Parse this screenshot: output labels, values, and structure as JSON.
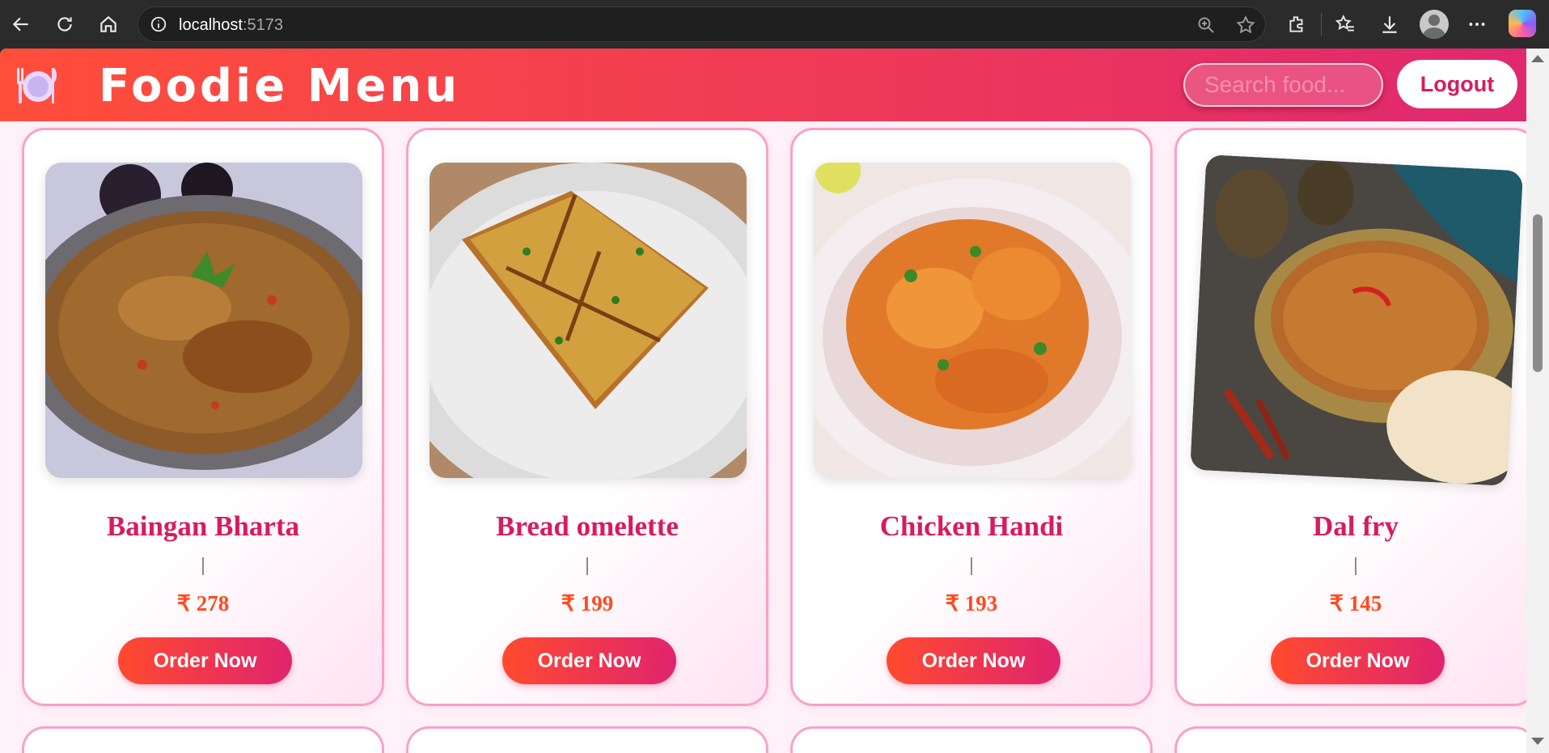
{
  "browser": {
    "url_host": "localhost",
    "url_port": ":5173"
  },
  "header": {
    "title": "Foodie Menu",
    "search_placeholder": "Search food...",
    "logout_label": "Logout"
  },
  "menu": {
    "items": [
      {
        "name": "Baingan Bharta",
        "divider": "|",
        "price": "₹ 278",
        "order_label": "Order Now"
      },
      {
        "name": "Bread omelette",
        "divider": "|",
        "price": "₹ 199",
        "order_label": "Order Now"
      },
      {
        "name": "Chicken Handi",
        "divider": "|",
        "price": "₹ 193",
        "order_label": "Order Now"
      },
      {
        "name": "Dal fry",
        "divider": "|",
        "price": "₹ 145",
        "order_label": "Order Now"
      }
    ]
  },
  "colors": {
    "header_gradient_start": "#ff4e3a",
    "header_gradient_end": "#e0286f",
    "accent_pink": "#d81b60",
    "price_orange": "#ff4a1f",
    "card_border": "#f8a2c8"
  }
}
